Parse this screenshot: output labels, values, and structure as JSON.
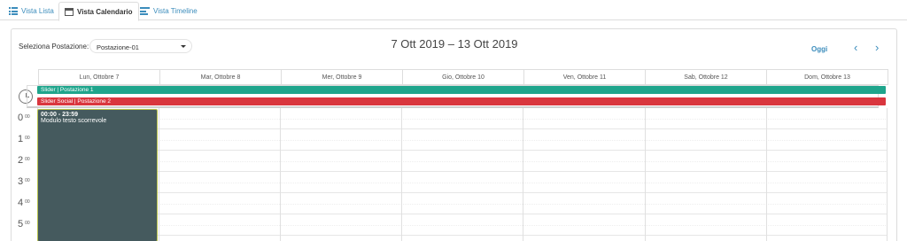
{
  "tabs": [
    {
      "label": "Vista Lista",
      "icon": "list-icon"
    },
    {
      "label": "Vista Calendario",
      "icon": "calendar-icon"
    },
    {
      "label": "Vista Timeline",
      "icon": "timeline-icon"
    }
  ],
  "toolbar": {
    "station_label": "Seleziona Postazione:",
    "station_value": "Postazione-01",
    "range_title": "7 Ott 2019 – 13 Ott 2019",
    "today_label": "Oggi",
    "prev_label": "‹",
    "next_label": "›"
  },
  "days": [
    "Lun, Ottobre 7",
    "Mar, Ottobre 8",
    "Mer, Ottobre 9",
    "Gio, Ottobre 10",
    "Ven, Ottobre 11",
    "Sab, Ottobre 12",
    "Dom, Ottobre 13"
  ],
  "allday_events": [
    {
      "label": "Slider | Postazione 1",
      "color": "#1fa58c"
    },
    {
      "label": "Slider Social | Postazione 2",
      "color": "#d9363e"
    }
  ],
  "hours": [
    {
      "h": "0",
      "m": "00"
    },
    {
      "h": "1",
      "m": "00"
    },
    {
      "h": "2",
      "m": "00"
    },
    {
      "h": "3",
      "m": "00"
    },
    {
      "h": "4",
      "m": "00"
    },
    {
      "h": "5",
      "m": "00"
    }
  ],
  "event": {
    "time": "00:00 - 23:59",
    "title": "Modulo testo scorrevole",
    "color": "#455a5e"
  },
  "colors": {
    "accent": "#3c8dbc"
  }
}
